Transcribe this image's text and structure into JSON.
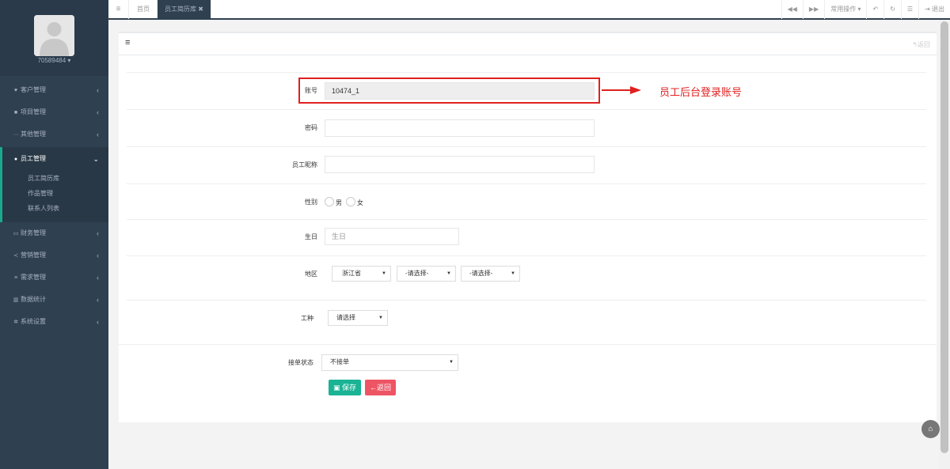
{
  "sidebar": {
    "username": "70589484",
    "items": [
      {
        "label": "客户管理",
        "icon": "heart-icon"
      },
      {
        "label": "项目管理",
        "icon": "briefcase-icon"
      },
      {
        "label": "其他管理",
        "icon": "ellipsis-icon"
      },
      {
        "label": "员工管理",
        "icon": "users-icon"
      },
      {
        "label": "财务管理",
        "icon": "money-icon"
      },
      {
        "label": "营销管理",
        "icon": "share-icon"
      },
      {
        "label": "需求管理",
        "icon": "list-icon"
      },
      {
        "label": "数据统计",
        "icon": "bar-chart-icon"
      },
      {
        "label": "系统设置",
        "icon": "gear-icon"
      }
    ],
    "subitems": [
      "员工简历库",
      "作品管理",
      "联系人列表"
    ]
  },
  "topbar": {
    "tabs": [
      "首页",
      "员工简历库"
    ],
    "common_ops": "常用操作",
    "logout": "退出"
  },
  "panel": {
    "back_link": "返回"
  },
  "form": {
    "account_label": "账号",
    "account_value": "10474_1",
    "password_label": "密码",
    "nickname_label": "员工昵称",
    "gender_label": "性别",
    "gender_male": "男",
    "gender_female": "女",
    "birthday_label": "生日",
    "birthday_placeholder": "生日",
    "region_label": "地区",
    "province": "浙江省",
    "city": "-请选择-",
    "district": "-请选择-",
    "worktype_label": "工种",
    "worktype": "请选择",
    "order_label": "接单状态",
    "order_status": "不接单",
    "save": "保存",
    "back": "返回"
  },
  "annotation": {
    "note": "员工后台登录账号",
    "color": "#e02020"
  },
  "colors": {
    "sidebar": "#2f4050",
    "accent": "#19aa8d",
    "save": "#1ab394",
    "back": "#ed5565"
  }
}
